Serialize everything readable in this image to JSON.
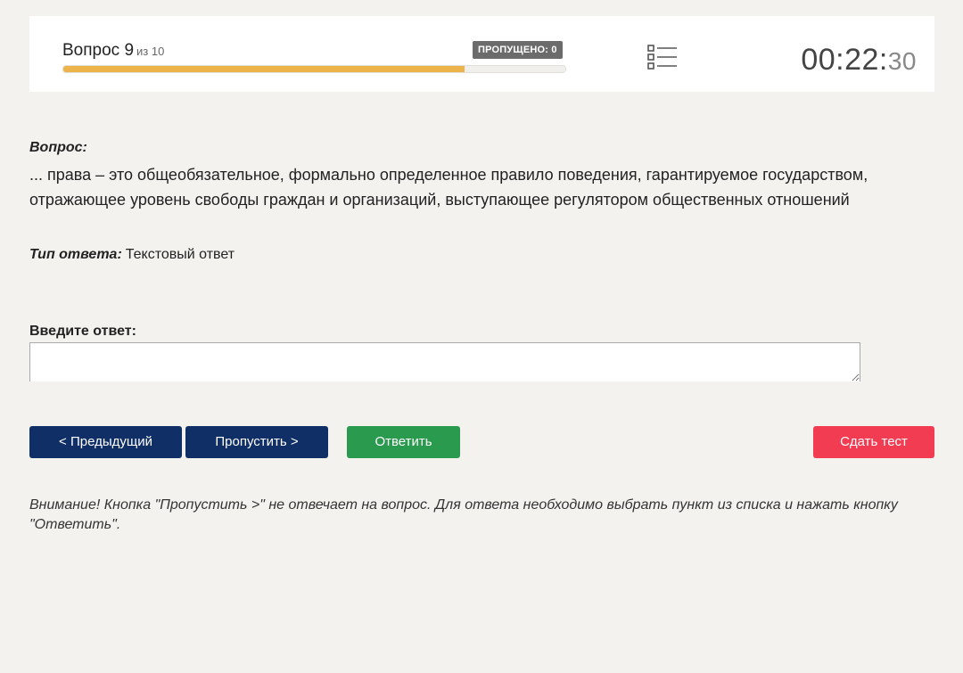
{
  "header": {
    "question_label": "Вопрос 9",
    "question_of": "из 10",
    "skipped_badge": "ПРОПУЩЕНО: 0",
    "progress": 0.8,
    "progress_color": "#ecb44a",
    "list_icon": "list-icon",
    "timer_main": "00:22:",
    "timer_seconds": "30"
  },
  "question": {
    "label": "Вопрос:",
    "text": "... права – это общеобязательное, формально определенное правило поведения, гарантируемое государством, отражающее уровень свободы граждан и организаций, выступающее регулятором общественных отношений"
  },
  "answer_type": {
    "label": "Тип ответа:",
    "value": "Текстовый ответ"
  },
  "answer_input": {
    "label": "Введите ответ:",
    "value": ""
  },
  "buttons": {
    "prev": "< Предыдущий",
    "skip": "Пропустить >",
    "answer": "Ответить",
    "submit": "Сдать тест"
  },
  "colors": {
    "nav_button": "#0f2f66",
    "answer_button": "#2a9a4e",
    "submit_button": "#f23c52"
  },
  "notice": "Внимание! Кнопка \"Пропустить >\" не отвечает на вопрос. Для ответа необходимо выбрать пункт из списка и нажать кнопку \"Ответить\"."
}
